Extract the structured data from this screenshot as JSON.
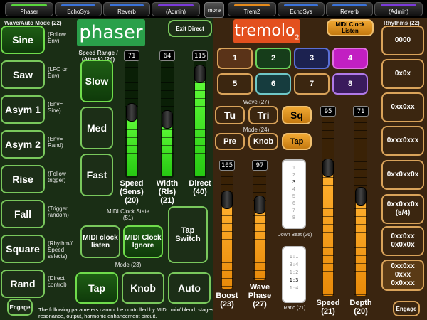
{
  "tabs": {
    "left": [
      {
        "label": "Phaser",
        "color": "#59d63c"
      },
      {
        "label": "EchoSys",
        "color": "#3a72d9"
      },
      {
        "label": "Reverb",
        "color": "#3a72d9"
      },
      {
        "label": "(Admin)",
        "color": "#7a3ad9"
      }
    ],
    "more": "more",
    "right": [
      {
        "label": "Trem2",
        "color": "#e68a1a"
      },
      {
        "label": "EchoSys",
        "color": "#3a72d9"
      },
      {
        "label": "Reverb",
        "color": "#3a72d9"
      },
      {
        "label": "(Admin)",
        "color": "#7a3ad9"
      }
    ]
  },
  "phaser": {
    "title": "phaser",
    "exit_direct": "Exit Direct",
    "wave_mode_label": "Wave/Auto Mode (22)",
    "waves": [
      {
        "label": "Sine",
        "desc": "(Follow Env)"
      },
      {
        "label": "Saw",
        "desc": "(LFO on Env)"
      },
      {
        "label": "Asym 1",
        "desc": "(Env= Sine)"
      },
      {
        "label": "Asym 2",
        "desc": "(Env= Rand)"
      },
      {
        "label": "Rise",
        "desc": "(Follow trigger)"
      },
      {
        "label": "Fall",
        "desc": "(Trigger random)"
      },
      {
        "label": "Square",
        "desc": "(Rhythm// Speed selects)"
      },
      {
        "label": "Rand",
        "desc": "(Direct control)"
      }
    ],
    "speed_range_label": "Speed Range / (Attack) (24)",
    "speed_range": [
      "Slow",
      "Med",
      "Fast"
    ],
    "sliders": [
      {
        "readout": "71",
        "label": "Speed (Sens) (20)",
        "level": 0.56
      },
      {
        "readout": "64",
        "label": "Width (Rls) (21)",
        "level": 0.5
      },
      {
        "readout": "115",
        "label": "Direct (40)",
        "level": 0.9
      }
    ],
    "midi_clock_label": "MIDI Clock State (51)",
    "midi_clock_listen": "MIDI clock listen",
    "midi_clock_ignore": "MIDI Clock Ignore",
    "tap_switch": "Tap Switch",
    "mode_label": "Mode (23)",
    "modes": [
      "Tap",
      "Knob",
      "Auto"
    ],
    "engage": "Engage",
    "footnote": "The following parameters cannot be controlled by MIDI:  mix/ blend, stages, resonance, output, harmonic enhancement circuit."
  },
  "tremolo": {
    "title": "tremolo",
    "title_sub": "2",
    "midi_clock_listen": "MIDI Clock Listen",
    "numbers": [
      {
        "label": "1",
        "border": "#d9a35a",
        "bg": "#5a3318"
      },
      {
        "label": "2",
        "border": "#6ad25b",
        "bg": "#163d1a"
      },
      {
        "label": "3",
        "border": "#5a6fd6",
        "bg": "#1c2250"
      },
      {
        "label": "4",
        "border": "#e070e0",
        "bg": "#c21fc2"
      },
      {
        "label": "5",
        "border": "#d9a35a",
        "bg": "#3b2610"
      },
      {
        "label": "6",
        "border": "#6fc7c7",
        "bg": "#163c3e"
      },
      {
        "label": "7",
        "border": "#d9a35a",
        "bg": "#3b2610"
      },
      {
        "label": "8",
        "border": "#b079e8",
        "bg": "#3a1b5c"
      }
    ],
    "wave_label": "Wave (27)",
    "waves": [
      "Tu",
      "Tri",
      "Sq"
    ],
    "mode_label": "Mode (24)",
    "modes": [
      "Pre",
      "Knob",
      "Tap"
    ],
    "down_beat_label": "Down Beat (26)",
    "down_beat_list": [
      "1",
      "2",
      "3",
      "4",
      "5",
      "6",
      "7",
      "8"
    ],
    "ratio_label": "Ratio (21)",
    "ratio_list": [
      "1:1",
      "3:4",
      "1:2",
      "1:3",
      "1:4"
    ],
    "sliders": [
      {
        "readout": "105",
        "label": "Boost (23)",
        "level": 0.76
      },
      {
        "readout": "97",
        "label": "Wave Phase (27)",
        "level": 0.7
      },
      {
        "readout": "95",
        "label": "Speed (21)",
        "level": 0.72
      },
      {
        "readout": "71",
        "label": "Depth (20)",
        "level": 0.56
      }
    ],
    "rhythms_label": "Rhythms (22)",
    "rhythms": [
      "0000",
      "0x0x",
      "0xx0xx",
      "0xxx0xxx",
      "0xx0xx0x",
      "0xx0xx0x (5/4)",
      "0xx0xx 0x0x0x",
      "0xx0xx 0xxx 0x0xxx"
    ],
    "engage": "Engage"
  }
}
